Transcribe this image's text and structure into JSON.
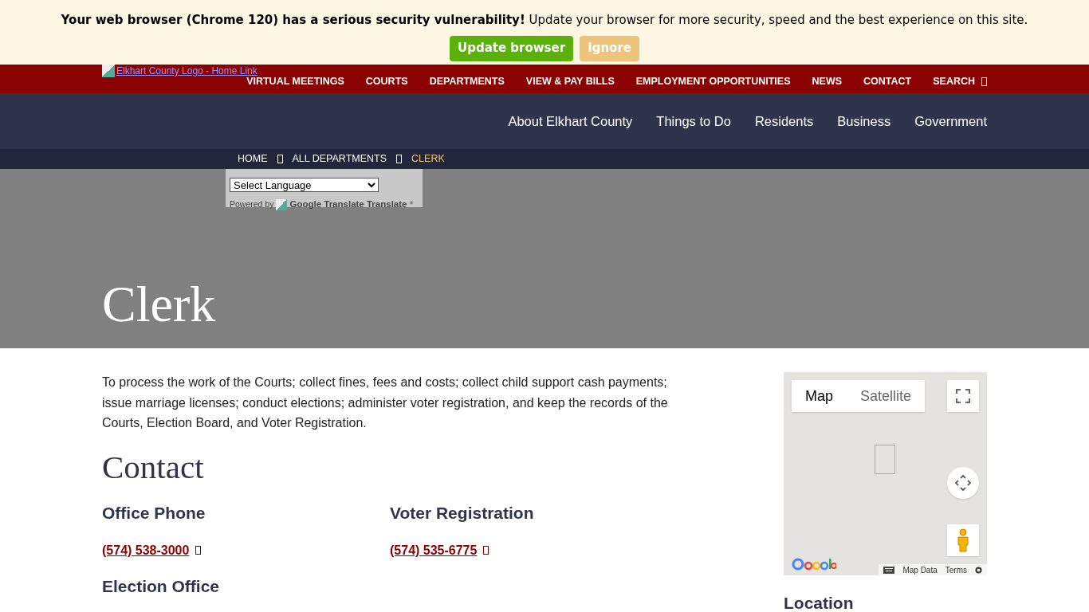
{
  "alert": {
    "message": "Your web browser (Chrome 120) has a serious security vulnerability!",
    "detail": "Update your browser for more security, speed and the best experience on this site.",
    "buttons": [
      {
        "label": "Update browser",
        "kind": "primary"
      },
      {
        "label": "Ignore",
        "kind": "secondary"
      }
    ]
  },
  "logo_alt": "Elkhart County Logo - Home Link",
  "utility_nav": [
    {
      "label": "VIRTUAL MEETINGS"
    },
    {
      "label": "COURTS"
    },
    {
      "label": "DEPARTMENTS"
    },
    {
      "label": "VIEW & PAY BILLS"
    },
    {
      "label": "EMPLOYMENT OPPORTUNITIES"
    },
    {
      "label": "NEWS"
    },
    {
      "label": "CONTACT"
    },
    {
      "label": "SEARCH",
      "kind": "search"
    }
  ],
  "main_nav": [
    "About Elkhart County",
    "Things to Do",
    "Residents",
    "Business",
    "Government"
  ],
  "breadcrumb": [
    {
      "label": "HOME",
      "selected": false
    },
    {
      "label": "ALL DEPARTMENTS",
      "selected": false
    },
    {
      "label": "CLERK",
      "selected": true
    }
  ],
  "translate": {
    "select": "Select Language",
    "powered_by": "Powered by",
    "brand": "Google Translate Translate",
    "mark": "*"
  },
  "page_title": "Clerk",
  "intro": "To process the work of the Courts; collect fines, fees and costs; collect child support cash payments; issue marriage licenses; conduct elections; administer voter registration, and keep the records of the Courts, Election Board, and Voter Registration.",
  "contact_heading": "Contact",
  "contacts": [
    {
      "title": "Office Phone",
      "phone": "(574) 538-3000"
    },
    {
      "title": "Voter Registration",
      "phone": "(574) 535-6775"
    },
    {
      "title": "Election Office"
    }
  ],
  "map": {
    "types": [
      {
        "label": "Map",
        "selected": true
      },
      {
        "label": "Satellite",
        "selected": false
      }
    ],
    "footer": [
      "Map Data",
      "Terms"
    ]
  },
  "location_heading": "Location"
}
